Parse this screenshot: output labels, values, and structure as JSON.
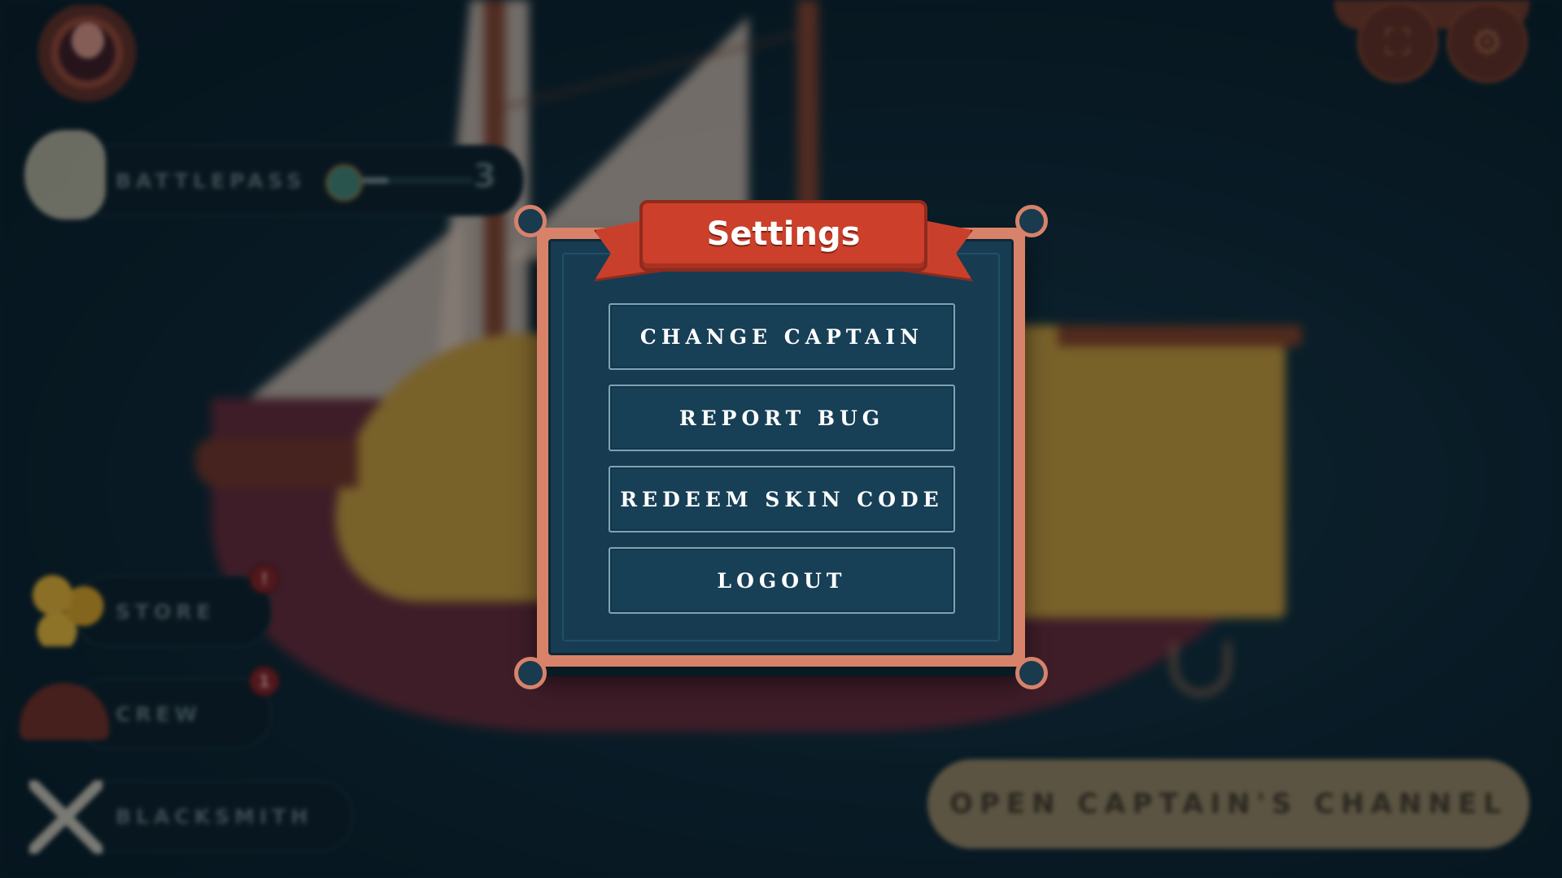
{
  "hud": {
    "battlepass_label": "BATTLEPASS",
    "battlepass_level": "3",
    "battlepass_progress": 0.35,
    "store_label": "STORE",
    "store_badge": "!",
    "crew_label": "CREW",
    "crew_badge": "1",
    "blacksmith_label": "BLACKSMITH",
    "channel_button": "OPEN CAPTAIN'S CHANNEL"
  },
  "modal": {
    "title": "Settings",
    "buttons": [
      {
        "label": "CHANGE CAPTAIN"
      },
      {
        "label": "REPORT BUG"
      },
      {
        "label": "REDEEM SKIN CODE"
      },
      {
        "label": "LOGOUT"
      }
    ]
  },
  "colors": {
    "modal_frame": "#d8826a",
    "modal_panel": "#173c52",
    "ribbon": "#cc3f2a",
    "button_border": "#7fa3b4"
  },
  "icons": {
    "avatar": "captain-avatar-icon",
    "battlepass": "skull-icon",
    "store": "coins-icon",
    "crew": "pirate-hat-icon",
    "blacksmith": "crossed-swords-icon",
    "fullscreen": "fullscreen-icon",
    "settings": "gear-icon"
  }
}
